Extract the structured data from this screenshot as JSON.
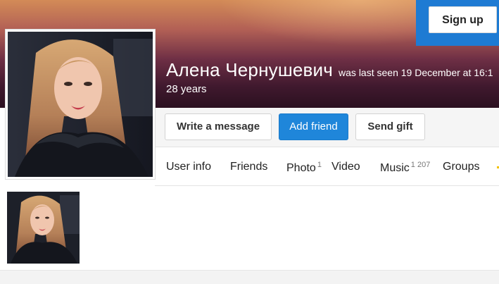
{
  "header": {
    "signup_label": "Sign up"
  },
  "profile": {
    "name": "Алена Чернушевич",
    "last_seen": "was last seen 19 December at 16:1",
    "age": "28 years"
  },
  "actions": {
    "write_message": "Write a message",
    "add_friend": "Add friend",
    "send_gift": "Send gift"
  },
  "nav": {
    "tabs": [
      {
        "label": "User info",
        "count": ""
      },
      {
        "label": "Friends",
        "count": ""
      },
      {
        "label": "Photo",
        "count": "1"
      },
      {
        "label": "Video",
        "count": ""
      },
      {
        "label": "Music",
        "count": "1 207"
      },
      {
        "label": "Groups",
        "count": ""
      }
    ]
  },
  "colors": {
    "accent_blue": "#1f86da",
    "signup_panel": "#1e7bd3",
    "cover_top": "#d38b57",
    "cover_bottom": "#2b1020"
  },
  "icons": {
    "avatar": "profile-photo",
    "thumbnail": "photo-thumbnail"
  }
}
